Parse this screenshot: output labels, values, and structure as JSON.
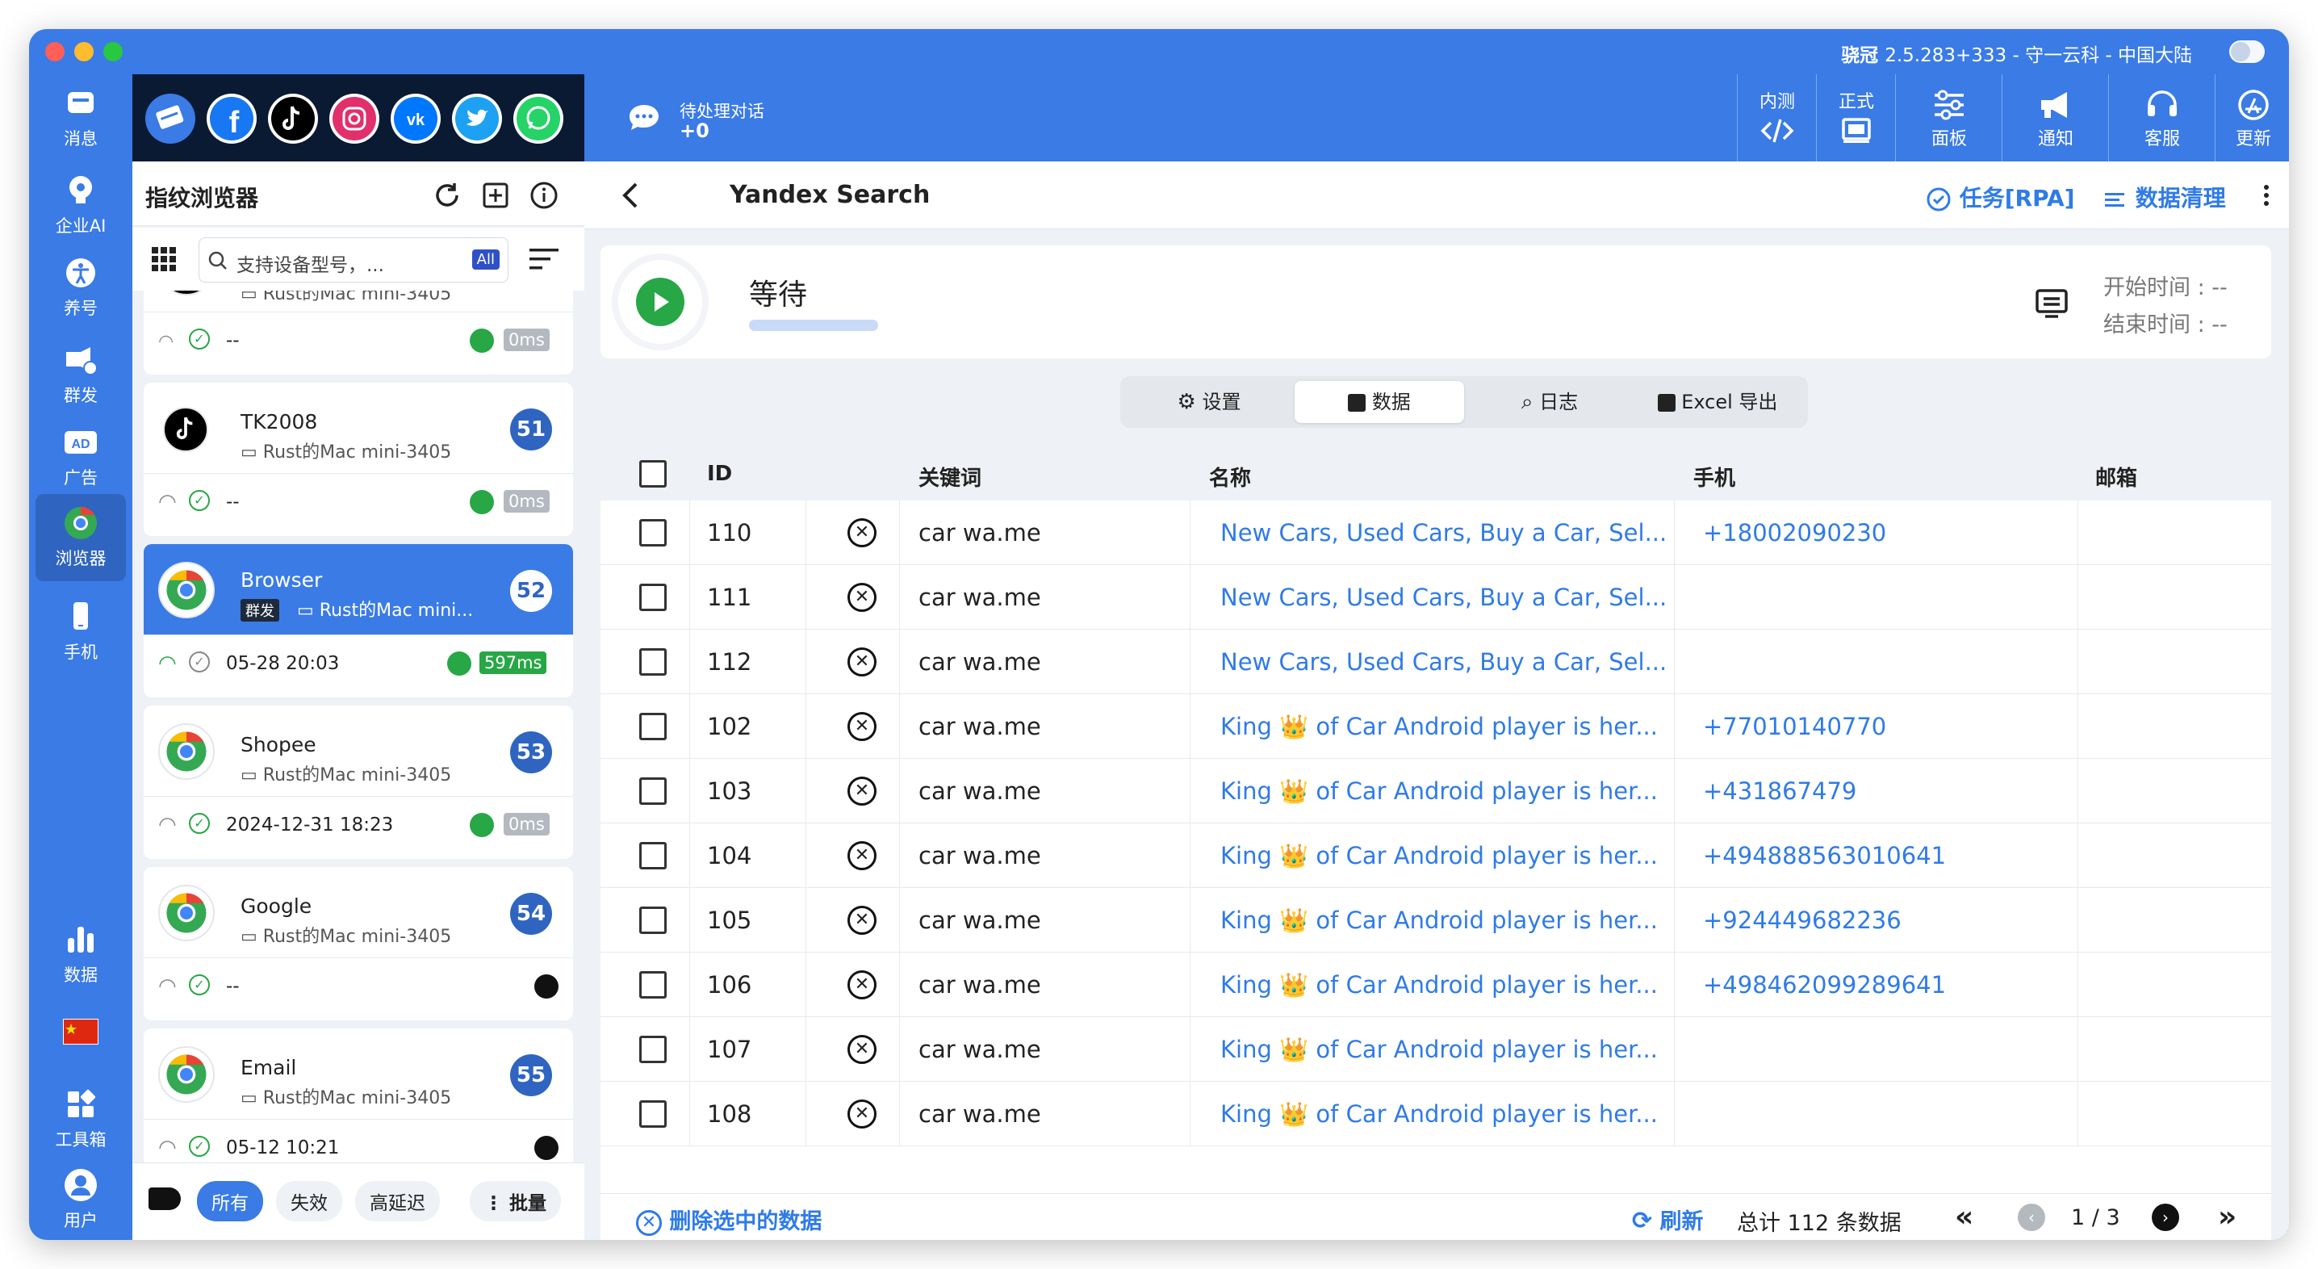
{
  "window": {
    "title_app": "骁冠",
    "title_rest": "2.5.283+333 - 守一云科 - 中国大陆"
  },
  "leftnav": [
    {
      "label": "消息",
      "icon": "message-icon"
    },
    {
      "label": "企业AI",
      "icon": "ai-icon"
    },
    {
      "label": "养号",
      "icon": "accessibility-icon"
    },
    {
      "label": "群发",
      "icon": "megaphone-icon"
    },
    {
      "label": "广告",
      "icon": "ad-icon"
    },
    {
      "label": "浏览器",
      "icon": "chrome-icon"
    },
    {
      "label": "手机",
      "icon": "phone-icon"
    },
    {
      "label": "数据",
      "icon": "bar-chart-icon"
    },
    {
      "label": "工具箱",
      "icon": "apps-icon"
    },
    {
      "label": "用户",
      "icon": "user-icon"
    }
  ],
  "social": [
    "bulk-icon",
    "facebook-icon",
    "tiktok-icon",
    "instagram-icon",
    "vk-icon",
    "twitter-icon",
    "whatsapp-icon"
  ],
  "panel": {
    "title": "指纹浏览器",
    "search_placeholder": "支持设备型号，...",
    "search_badge": "All",
    "cards": [
      {
        "name": "",
        "device": "Rust的Mac mini-3405",
        "badge": "",
        "time": "--",
        "latency": "0ms",
        "logo": "tiktok"
      },
      {
        "name": "TK2008",
        "device": "Rust的Mac mini-3405",
        "badge": "51",
        "time": "--",
        "latency": "0ms",
        "logo": "tiktok"
      },
      {
        "name": "Browser",
        "device": "Rust的Mac mini...",
        "tag": "群发",
        "badge": "52",
        "time": "05-28 20:03",
        "latency": "597ms",
        "logo": "chrome"
      },
      {
        "name": "Shopee",
        "device": "Rust的Mac mini-3405",
        "badge": "53",
        "time": "2024-12-31 18:23",
        "latency": "0ms",
        "logo": "chrome"
      },
      {
        "name": "Google",
        "device": "Rust的Mac mini-3405",
        "badge": "54",
        "time": "--",
        "latency": "",
        "logo": "chrome"
      },
      {
        "name": "Email",
        "device": "Rust的Mac mini-3405",
        "badge": "55",
        "time": "05-12 10:21",
        "latency": "",
        "logo": "chrome"
      }
    ],
    "filters": [
      "所有",
      "失效",
      "高延迟"
    ],
    "batch": "批量"
  },
  "topbar": {
    "pending_label": "待处理对话",
    "pending_count": "+0",
    "buttons": [
      "内测",
      "正式",
      "面板",
      "通知",
      "客服",
      "更新"
    ]
  },
  "subbar": {
    "title": "Yandex Search",
    "task": "任务[RPA]",
    "clean": "数据清理"
  },
  "status": {
    "state": "等待",
    "start": "开始时间 : --",
    "end": "结束时间 : --"
  },
  "tabs": [
    "设置",
    "数据",
    "日志",
    "Excel 导出"
  ],
  "table": {
    "headers": [
      "ID",
      "关键词",
      "名称",
      "手机",
      "邮箱"
    ],
    "rows": [
      {
        "id": "110",
        "kw": "car wa.me",
        "name": "New Cars, Used Cars, Buy a Car, Sel...",
        "phone": "+18002090230"
      },
      {
        "id": "111",
        "kw": "car wa.me",
        "name": "New Cars, Used Cars, Buy a Car, Sel...",
        "phone": ""
      },
      {
        "id": "112",
        "kw": "car wa.me",
        "name": "New Cars, Used Cars, Buy a Car, Sel...",
        "phone": ""
      },
      {
        "id": "102",
        "kw": "car wa.me",
        "name": "King 👑 of Car Android player is her...",
        "phone": "+77010140770"
      },
      {
        "id": "103",
        "kw": "car wa.me",
        "name": "King 👑 of Car Android player is her...",
        "phone": "+431867479"
      },
      {
        "id": "104",
        "kw": "car wa.me",
        "name": "King 👑 of Car Android player is her...",
        "phone": "+494888563010641"
      },
      {
        "id": "105",
        "kw": "car wa.me",
        "name": "King 👑 of Car Android player is her...",
        "phone": "+924449682236"
      },
      {
        "id": "106",
        "kw": "car wa.me",
        "name": "King 👑 of Car Android player is her...",
        "phone": "+498462099289641"
      },
      {
        "id": "107",
        "kw": "car wa.me",
        "name": "King 👑 of Car Android player is her...",
        "phone": ""
      },
      {
        "id": "108",
        "kw": "car wa.me",
        "name": "King 👑 of Car Android player is her...",
        "phone": ""
      }
    ]
  },
  "footer": {
    "delete": "删除选中的数据",
    "refresh": "刷新",
    "total": "总计 112 条数据",
    "page": "1 / 3"
  },
  "colors": {
    "brand": "#3a7be6",
    "link": "#2f7be8",
    "dark": "#0b1a33",
    "green": "#27a745"
  }
}
